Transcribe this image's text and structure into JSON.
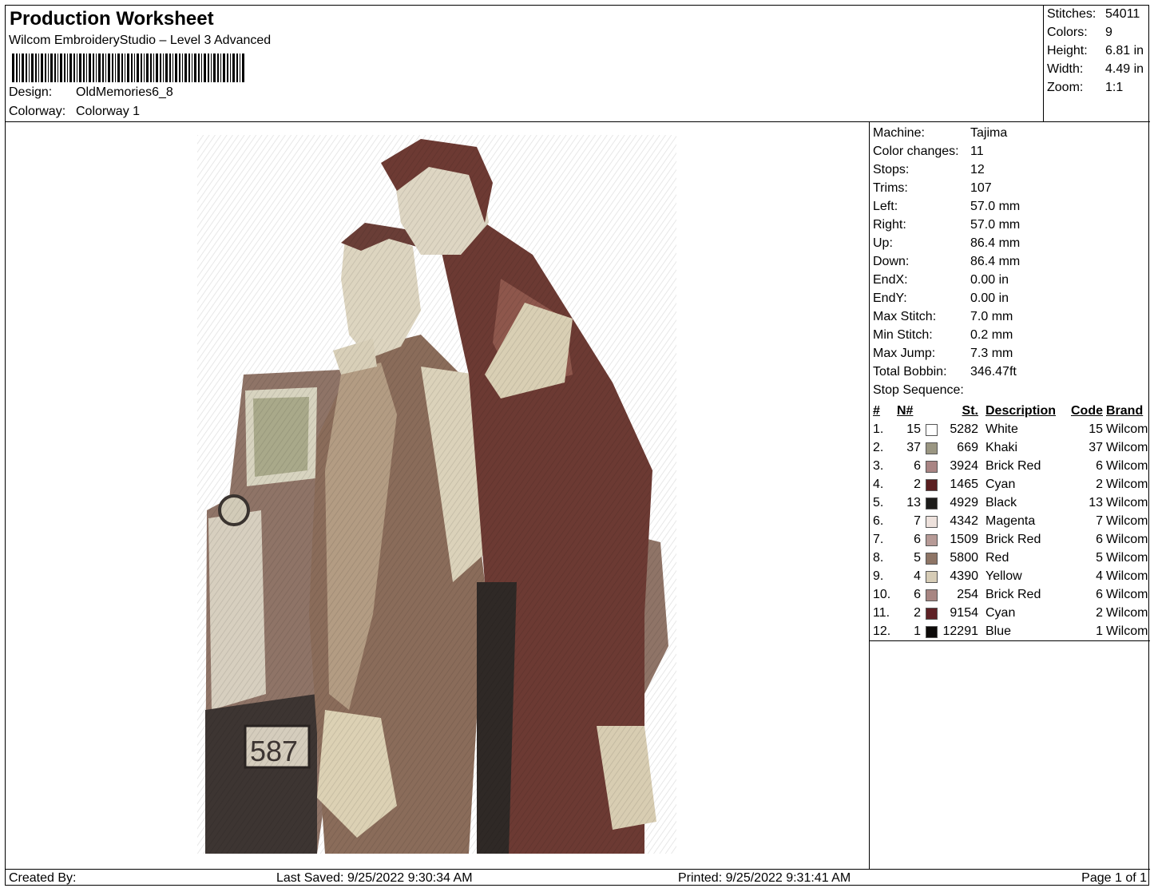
{
  "header": {
    "title": "Production Worksheet",
    "software": "Wilcom EmbroideryStudio – Level 3 Advanced",
    "design_label": "Design:",
    "design_value": "OldMemories6_8",
    "colorway_label": "Colorway:",
    "colorway_value": "Colorway 1"
  },
  "summary": [
    {
      "label": "Stitches:",
      "value": "54011"
    },
    {
      "label": "Colors:",
      "value": "9"
    },
    {
      "label": "Height:",
      "value": "6.81 in"
    },
    {
      "label": "Width:",
      "value": "4.49 in"
    },
    {
      "label": "Zoom:",
      "value": "1:1"
    }
  ],
  "machine_info": [
    {
      "label": "Machine:",
      "value": "Tajima"
    },
    {
      "label": "Color changes:",
      "value": "11"
    },
    {
      "label": "Stops:",
      "value": "12"
    },
    {
      "label": "Trims:",
      "value": "107"
    },
    {
      "label": "Left:",
      "value": "57.0 mm"
    },
    {
      "label": "Right:",
      "value": "57.0 mm"
    },
    {
      "label": "Up:",
      "value": "86.4 mm"
    },
    {
      "label": "Down:",
      "value": "86.4 mm"
    },
    {
      "label": "EndX:",
      "value": "0.00 in"
    },
    {
      "label": "EndY:",
      "value": "0.00 in"
    },
    {
      "label": "Max Stitch:",
      "value": "7.0 mm"
    },
    {
      "label": "Min Stitch:",
      "value": "0.2 mm"
    },
    {
      "label": "Max Jump:",
      "value": "7.3 mm"
    },
    {
      "label": "Total Bobbin:",
      "value": "346.47ft"
    }
  ],
  "stop_sequence": {
    "title": "Stop Sequence:",
    "columns": {
      "idx": "#",
      "n": "N#",
      "st": "St.",
      "desc": "Description",
      "code": "Code",
      "brand": "Brand"
    },
    "rows": [
      {
        "idx": "1.",
        "n": "15",
        "color": "#ffffff",
        "st": "5282",
        "desc": "White",
        "code": "15",
        "brand": "Wilcom"
      },
      {
        "idx": "2.",
        "n": "37",
        "color": "#9a9682",
        "st": "669",
        "desc": "Khaki",
        "code": "37",
        "brand": "Wilcom"
      },
      {
        "idx": "3.",
        "n": "6",
        "color": "#a98584",
        "st": "3924",
        "desc": "Brick Red",
        "code": "6",
        "brand": "Wilcom"
      },
      {
        "idx": "4.",
        "n": "2",
        "color": "#5a1f20",
        "st": "1465",
        "desc": "Cyan",
        "code": "2",
        "brand": "Wilcom"
      },
      {
        "idx": "5.",
        "n": "13",
        "color": "#1d1c1a",
        "st": "4929",
        "desc": "Black",
        "code": "13",
        "brand": "Wilcom"
      },
      {
        "idx": "6.",
        "n": "7",
        "color": "#ede1dc",
        "st": "4342",
        "desc": "Magenta",
        "code": "7",
        "brand": "Wilcom"
      },
      {
        "idx": "7.",
        "n": "6",
        "color": "#b69a96",
        "st": "1509",
        "desc": "Brick Red",
        "code": "6",
        "brand": "Wilcom"
      },
      {
        "idx": "8.",
        "n": "5",
        "color": "#8e7566",
        "st": "5800",
        "desc": "Red",
        "code": "5",
        "brand": "Wilcom"
      },
      {
        "idx": "9.",
        "n": "4",
        "color": "#d6ccb6",
        "st": "4390",
        "desc": "Yellow",
        "code": "4",
        "brand": "Wilcom"
      },
      {
        "idx": "10.",
        "n": "6",
        "color": "#a88682",
        "st": "254",
        "desc": "Brick Red",
        "code": "6",
        "brand": "Wilcom"
      },
      {
        "idx": "11.",
        "n": "2",
        "color": "#5e2226",
        "st": "9154",
        "desc": "Cyan",
        "code": "2",
        "brand": "Wilcom"
      },
      {
        "idx": "12.",
        "n": "1",
        "color": "#0d0a09",
        "st": "12291",
        "desc": "Blue",
        "code": "1",
        "brand": "Wilcom"
      }
    ]
  },
  "footer": {
    "created_by": "Created By:",
    "last_saved": "Last Saved: 9/25/2022 9:30:34 AM",
    "printed": "Printed: 9/25/2022 9:31:41 AM",
    "page": "Page 1 of 1"
  }
}
